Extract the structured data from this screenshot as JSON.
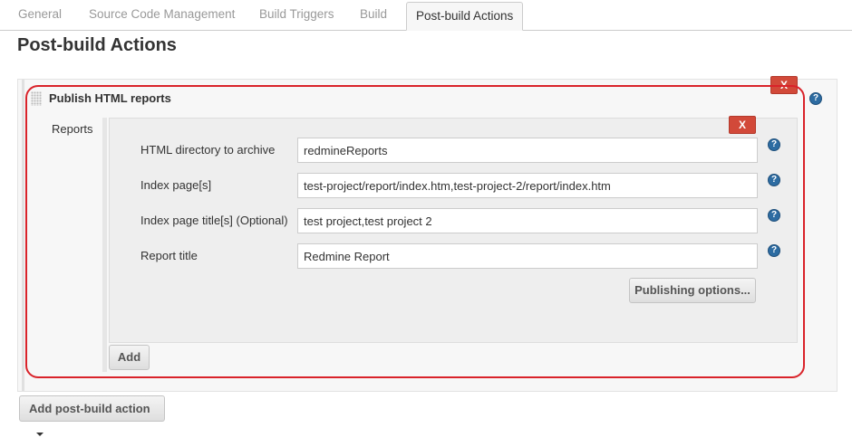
{
  "tabs": [
    {
      "label": "General"
    },
    {
      "label": "Source Code Management"
    },
    {
      "label": "Build Triggers"
    },
    {
      "label": "Build"
    },
    {
      "label": "Post-build Actions"
    }
  ],
  "page": {
    "title": "Post-build Actions"
  },
  "plugin": {
    "title": "Publish HTML reports",
    "delete_label": "X",
    "help_label": "?"
  },
  "reports": {
    "label": "Reports",
    "delete_label": "X",
    "fields": [
      {
        "label": "HTML directory to archive",
        "value": "redmineReports"
      },
      {
        "label": "Index page[s]",
        "value": "test-project/report/index.htm,test-project-2/report/index.htm"
      },
      {
        "label": "Index page title[s] (Optional)",
        "value": "test project,test project 2"
      },
      {
        "label": "Report title",
        "value": "Redmine Report"
      }
    ],
    "help_label": "?",
    "publishing_options_label": "Publishing options...",
    "add_label": "Add"
  },
  "footer": {
    "add_action_label": "Add post-build action"
  },
  "colors": {
    "highlight": "#d9232a",
    "delete_button": "#d24939",
    "help_icon": "#2d6ca2"
  }
}
